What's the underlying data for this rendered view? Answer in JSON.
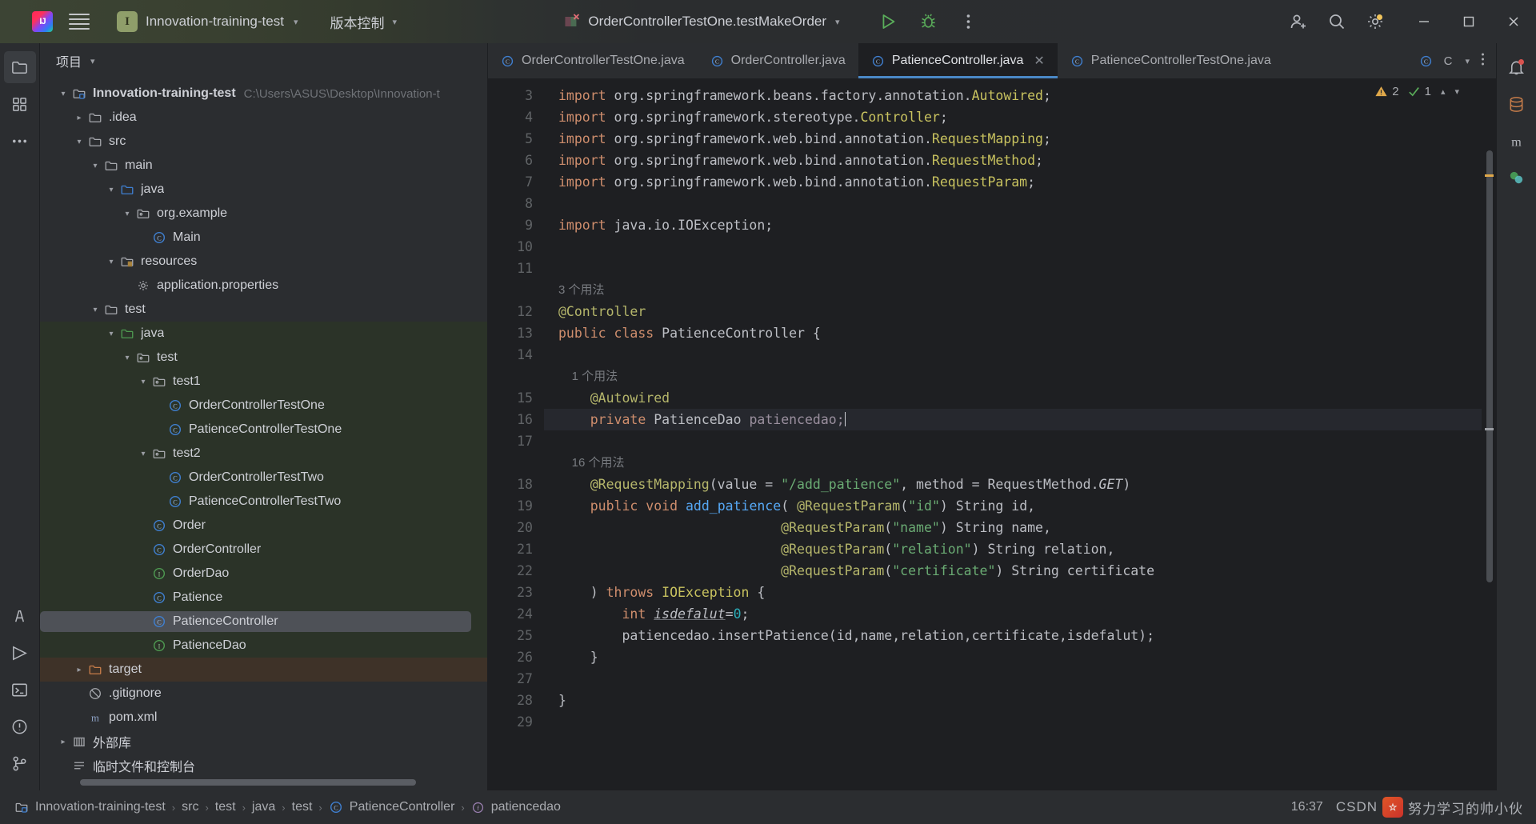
{
  "titlebar": {
    "menu_icon": "hamburger-icon",
    "logo_text": "IJ",
    "project_badge": "I",
    "project_name": "Innovation-training-test",
    "vcs_label": "版本控制",
    "run_config": "OrderControllerTestOne.testMakeOrder",
    "run_icon": "run-icon",
    "debug_icon": "debug-icon",
    "more_icon": "more-vertical-icon",
    "account_icon": "account-icon",
    "search_icon": "search-icon",
    "settings_icon": "gear-icon",
    "minimize": "minimize-icon",
    "maximize": "maximize-icon",
    "close": "close-icon"
  },
  "left_activity_bar": {
    "items": [
      {
        "name": "project-tool-window",
        "icon": "folder-icon",
        "selected": true
      },
      {
        "name": "structure-tool-window",
        "icon": "structure-icon",
        "selected": false
      },
      {
        "name": "more-tool-windows",
        "icon": "ellipsis-icon",
        "selected": false
      }
    ],
    "bottom_items": [
      {
        "name": "ai-assistant",
        "icon": "ai-icon"
      },
      {
        "name": "run-tool-window",
        "icon": "run-window-icon"
      },
      {
        "name": "terminal-tool-window",
        "icon": "terminal-icon"
      },
      {
        "name": "problems-tool-window",
        "icon": "problems-icon"
      },
      {
        "name": "version-control-tool-window",
        "icon": "branch-icon"
      }
    ]
  },
  "project_panel": {
    "title": "项目",
    "title_chevron": "chevron-down-icon",
    "tree": [
      {
        "depth": 0,
        "label": "Innovation-training-test",
        "sub": "C:\\Users\\ASUS\\Desktop\\Innovation-t",
        "icon": "module-icon",
        "arrow": "expanded",
        "bold": true,
        "bg": "none"
      },
      {
        "depth": 1,
        "label": ".idea",
        "sub": "",
        "icon": "folder-icon",
        "arrow": "collapsed",
        "bold": false,
        "bg": "none"
      },
      {
        "depth": 1,
        "label": "src",
        "sub": "",
        "icon": "folder-icon",
        "arrow": "expanded",
        "bold": false,
        "bg": "none"
      },
      {
        "depth": 2,
        "label": "main",
        "sub": "",
        "icon": "folder-icon",
        "arrow": "expanded",
        "bold": false,
        "bg": "none"
      },
      {
        "depth": 3,
        "label": "java",
        "sub": "",
        "icon": "source-root-icon",
        "arrow": "expanded",
        "bold": false,
        "bg": "none"
      },
      {
        "depth": 4,
        "label": "org.example",
        "sub": "",
        "icon": "package-icon",
        "arrow": "expanded",
        "bold": false,
        "bg": "none"
      },
      {
        "depth": 5,
        "label": "Main",
        "sub": "",
        "icon": "class-icon",
        "arrow": "none",
        "bold": false,
        "bg": "none"
      },
      {
        "depth": 3,
        "label": "resources",
        "sub": "",
        "icon": "resource-root-icon",
        "arrow": "expanded",
        "bold": false,
        "bg": "none"
      },
      {
        "depth": 4,
        "label": "application.properties",
        "sub": "",
        "icon": "properties-icon",
        "arrow": "none",
        "bold": false,
        "bg": "none"
      },
      {
        "depth": 2,
        "label": "test",
        "sub": "",
        "icon": "folder-icon",
        "arrow": "expanded",
        "bold": false,
        "bg": "none"
      },
      {
        "depth": 3,
        "label": "java",
        "sub": "",
        "icon": "test-root-icon",
        "arrow": "expanded",
        "bold": false,
        "bg": "test"
      },
      {
        "depth": 4,
        "label": "test",
        "sub": "",
        "icon": "package-icon",
        "arrow": "expanded",
        "bold": false,
        "bg": "test"
      },
      {
        "depth": 5,
        "label": "test1",
        "sub": "",
        "icon": "package-icon",
        "arrow": "expanded",
        "bold": false,
        "bg": "test"
      },
      {
        "depth": 6,
        "label": "OrderControllerTestOne",
        "sub": "",
        "icon": "class-icon",
        "arrow": "none",
        "bold": false,
        "bg": "test"
      },
      {
        "depth": 6,
        "label": "PatienceControllerTestOne",
        "sub": "",
        "icon": "class-icon",
        "arrow": "none",
        "bold": false,
        "bg": "test"
      },
      {
        "depth": 5,
        "label": "test2",
        "sub": "",
        "icon": "package-icon",
        "arrow": "expanded",
        "bold": false,
        "bg": "test"
      },
      {
        "depth": 6,
        "label": "OrderControllerTestTwo",
        "sub": "",
        "icon": "class-icon",
        "arrow": "none",
        "bold": false,
        "bg": "test"
      },
      {
        "depth": 6,
        "label": "PatienceControllerTestTwo",
        "sub": "",
        "icon": "class-icon",
        "arrow": "none",
        "bold": false,
        "bg": "test"
      },
      {
        "depth": 5,
        "label": "Order",
        "sub": "",
        "icon": "class-icon",
        "arrow": "none",
        "bold": false,
        "bg": "test"
      },
      {
        "depth": 5,
        "label": "OrderController",
        "sub": "",
        "icon": "class-icon",
        "arrow": "none",
        "bold": false,
        "bg": "test"
      },
      {
        "depth": 5,
        "label": "OrderDao",
        "sub": "",
        "icon": "interface-icon",
        "arrow": "none",
        "bold": false,
        "bg": "test"
      },
      {
        "depth": 5,
        "label": "Patience",
        "sub": "",
        "icon": "class-icon",
        "arrow": "none",
        "bold": false,
        "bg": "test"
      },
      {
        "depth": 5,
        "label": "PatienceController",
        "sub": "",
        "icon": "class-icon",
        "arrow": "none",
        "bold": false,
        "bg": "test",
        "selected": true
      },
      {
        "depth": 5,
        "label": "PatienceDao",
        "sub": "",
        "icon": "interface-icon",
        "arrow": "none",
        "bold": false,
        "bg": "test"
      },
      {
        "depth": 1,
        "label": "target",
        "sub": "",
        "icon": "excluded-folder-icon",
        "arrow": "collapsed",
        "bold": false,
        "bg": "target"
      },
      {
        "depth": 1,
        "label": ".gitignore",
        "sub": "",
        "icon": "gitignore-icon",
        "arrow": "none",
        "bold": false,
        "bg": "none"
      },
      {
        "depth": 1,
        "label": "pom.xml",
        "sub": "",
        "icon": "maven-icon",
        "arrow": "none",
        "bold": false,
        "bg": "none"
      },
      {
        "depth": 0,
        "label": "外部库",
        "sub": "",
        "icon": "library-icon",
        "arrow": "collapsed",
        "bold": false,
        "bg": "none"
      },
      {
        "depth": 0,
        "label": "临时文件和控制台",
        "sub": "",
        "icon": "scratches-icon",
        "arrow": "none",
        "bold": false,
        "bg": "none"
      }
    ]
  },
  "editor": {
    "tabs": [
      {
        "label": "OrderControllerTestOne.java",
        "icon": "java-class-icon",
        "active": false,
        "closable": false
      },
      {
        "label": "OrderController.java",
        "icon": "java-class-icon",
        "active": false,
        "closable": false
      },
      {
        "label": "PatienceController.java",
        "icon": "java-class-icon",
        "active": true,
        "closable": true
      },
      {
        "label": "PatienceControllerTestOne.java",
        "icon": "java-class-icon",
        "active": false,
        "closable": false
      }
    ],
    "tab_overflow_icon": "chevron-down-icon",
    "tab_more_icon": "more-vertical-icon",
    "inspection": {
      "warning_icon": "warning-triangle-icon",
      "warning_count": "2",
      "ok_icon": "check-icon",
      "ok_count": "1",
      "prev_icon": "chevron-up-icon",
      "next_icon": "chevron-down-icon"
    },
    "lines": [
      {
        "no": "3",
        "hint": "",
        "tokens": [
          {
            "t": "import ",
            "c": "k"
          },
          {
            "t": "org.springframework.beans.factory.annotation.",
            "c": "idf"
          },
          {
            "t": "Autowired",
            "c": "cls"
          },
          {
            "t": ";",
            "c": "idf"
          }
        ]
      },
      {
        "no": "4",
        "hint": "",
        "tokens": [
          {
            "t": "import ",
            "c": "k"
          },
          {
            "t": "org.springframework.stereotype.",
            "c": "idf"
          },
          {
            "t": "Controller",
            "c": "cls"
          },
          {
            "t": ";",
            "c": "idf"
          }
        ]
      },
      {
        "no": "5",
        "hint": "",
        "tokens": [
          {
            "t": "import ",
            "c": "k"
          },
          {
            "t": "org.springframework.web.bind.annotation.",
            "c": "idf"
          },
          {
            "t": "RequestMapping",
            "c": "cls"
          },
          {
            "t": ";",
            "c": "idf"
          }
        ]
      },
      {
        "no": "6",
        "hint": "",
        "tokens": [
          {
            "t": "import ",
            "c": "k"
          },
          {
            "t": "org.springframework.web.bind.annotation.",
            "c": "idf"
          },
          {
            "t": "RequestMethod",
            "c": "cls"
          },
          {
            "t": ";",
            "c": "idf"
          }
        ]
      },
      {
        "no": "7",
        "hint": "",
        "tokens": [
          {
            "t": "import ",
            "c": "k"
          },
          {
            "t": "org.springframework.web.bind.annotation.",
            "c": "idf"
          },
          {
            "t": "RequestParam",
            "c": "cls"
          },
          {
            "t": ";",
            "c": "idf"
          }
        ]
      },
      {
        "no": "8",
        "hint": "",
        "tokens": []
      },
      {
        "no": "9",
        "hint": "",
        "tokens": [
          {
            "t": "import ",
            "c": "k"
          },
          {
            "t": "java.io.IOException;",
            "c": "idf"
          }
        ]
      },
      {
        "no": "10",
        "hint": "",
        "tokens": []
      },
      {
        "no": "11",
        "hint": "",
        "tokens": []
      },
      {
        "no": "12",
        "hint": "3 个用法",
        "tokens": [
          {
            "t": "@Controller",
            "c": "an"
          }
        ]
      },
      {
        "no": "13",
        "hint": "",
        "tokens": [
          {
            "t": "public class ",
            "c": "k"
          },
          {
            "t": "PatienceController ",
            "c": "idf"
          },
          {
            "t": "{",
            "c": "idf"
          }
        ]
      },
      {
        "no": "14",
        "hint": "",
        "tokens": []
      },
      {
        "no": "15",
        "hint": "    1 个用法",
        "tokens": [
          {
            "t": "    @Autowired",
            "c": "an"
          }
        ]
      },
      {
        "no": "16",
        "hint": "",
        "highlight": true,
        "caret": true,
        "tokens": [
          {
            "t": "    ",
            "c": "idf"
          },
          {
            "t": "private ",
            "c": "k"
          },
          {
            "t": "PatienceDao ",
            "c": "idf"
          },
          {
            "t": "patiencedao;",
            "c": "fld"
          }
        ]
      },
      {
        "no": "17",
        "hint": "",
        "tokens": []
      },
      {
        "no": "18",
        "hint": "    16 个用法",
        "tokens": [
          {
            "t": "    @RequestMapping",
            "c": "an"
          },
          {
            "t": "(value = ",
            "c": "idf"
          },
          {
            "t": "\"/add_patience\"",
            "c": "st"
          },
          {
            "t": ", method = RequestMethod.",
            "c": "idf"
          },
          {
            "t": "GET",
            "c": "ital"
          },
          {
            "t": ")",
            "c": "idf"
          }
        ]
      },
      {
        "no": "19",
        "hint": "",
        "tokens": [
          {
            "t": "    ",
            "c": "idf"
          },
          {
            "t": "public void ",
            "c": "k"
          },
          {
            "t": "add_patience",
            "c": "mth"
          },
          {
            "t": "( ",
            "c": "idf"
          },
          {
            "t": "@RequestParam",
            "c": "an"
          },
          {
            "t": "(",
            "c": "idf"
          },
          {
            "t": "\"id\"",
            "c": "st"
          },
          {
            "t": ") String id,",
            "c": "idf"
          }
        ]
      },
      {
        "no": "20",
        "hint": "",
        "tokens": [
          {
            "t": "                            ",
            "c": "idf"
          },
          {
            "t": "@RequestParam",
            "c": "an"
          },
          {
            "t": "(",
            "c": "idf"
          },
          {
            "t": "\"name\"",
            "c": "st"
          },
          {
            "t": ") String name,",
            "c": "idf"
          }
        ]
      },
      {
        "no": "21",
        "hint": "",
        "tokens": [
          {
            "t": "                            ",
            "c": "idf"
          },
          {
            "t": "@RequestParam",
            "c": "an"
          },
          {
            "t": "(",
            "c": "idf"
          },
          {
            "t": "\"relation\"",
            "c": "st"
          },
          {
            "t": ") String relation,",
            "c": "idf"
          }
        ]
      },
      {
        "no": "22",
        "hint": "",
        "tokens": [
          {
            "t": "                            ",
            "c": "idf"
          },
          {
            "t": "@RequestParam",
            "c": "an"
          },
          {
            "t": "(",
            "c": "idf"
          },
          {
            "t": "\"certificate\"",
            "c": "st"
          },
          {
            "t": ") String certificate",
            "c": "idf"
          }
        ]
      },
      {
        "no": "23",
        "hint": "",
        "tokens": [
          {
            "t": "    ) ",
            "c": "idf"
          },
          {
            "t": "throws ",
            "c": "k"
          },
          {
            "t": "IOException",
            "c": "cls"
          },
          {
            "t": " {",
            "c": "idf"
          }
        ]
      },
      {
        "no": "24",
        "hint": "",
        "tokens": [
          {
            "t": "        ",
            "c": "idf"
          },
          {
            "t": "int ",
            "c": "k"
          },
          {
            "t": "isdefalut",
            "c": "stat"
          },
          {
            "t": "=",
            "c": "idf"
          },
          {
            "t": "0",
            "c": "num"
          },
          {
            "t": ";",
            "c": "idf"
          }
        ]
      },
      {
        "no": "25",
        "hint": "",
        "tokens": [
          {
            "t": "        patiencedao.",
            "c": "idf"
          },
          {
            "t": "insertPatience",
            "c": "idf"
          },
          {
            "t": "(id,name,relation,certificate,isdefalut);",
            "c": "idf"
          }
        ]
      },
      {
        "no": "26",
        "hint": "",
        "tokens": [
          {
            "t": "    }",
            "c": "idf"
          }
        ]
      },
      {
        "no": "27",
        "hint": "",
        "tokens": []
      },
      {
        "no": "28",
        "hint": "",
        "tokens": [
          {
            "t": "}",
            "c": "idf"
          }
        ]
      },
      {
        "no": "29",
        "hint": "",
        "tokens": []
      }
    ]
  },
  "right_activity_bar": {
    "items": [
      {
        "name": "notifications",
        "icon": "bell-icon"
      },
      {
        "name": "database",
        "icon": "database-icon"
      },
      {
        "name": "maven",
        "icon": "maven-m-icon"
      },
      {
        "name": "ai-chat",
        "icon": "ai-chat-icon"
      }
    ]
  },
  "statusbar": {
    "breadcrumbs": [
      {
        "label": "Innovation-training-test",
        "icon": "module-icon"
      },
      {
        "label": "src",
        "icon": "none"
      },
      {
        "label": "test",
        "icon": "none"
      },
      {
        "label": "java",
        "icon": "none"
      },
      {
        "label": "test",
        "icon": "none"
      },
      {
        "label": "PatienceController",
        "icon": "class-icon"
      },
      {
        "label": "patiencedao",
        "icon": "field-icon"
      }
    ],
    "separator": "›",
    "clock": "16:37",
    "watermark_site": "CSDN",
    "watermark_text": "努力学习的帅小伙"
  }
}
